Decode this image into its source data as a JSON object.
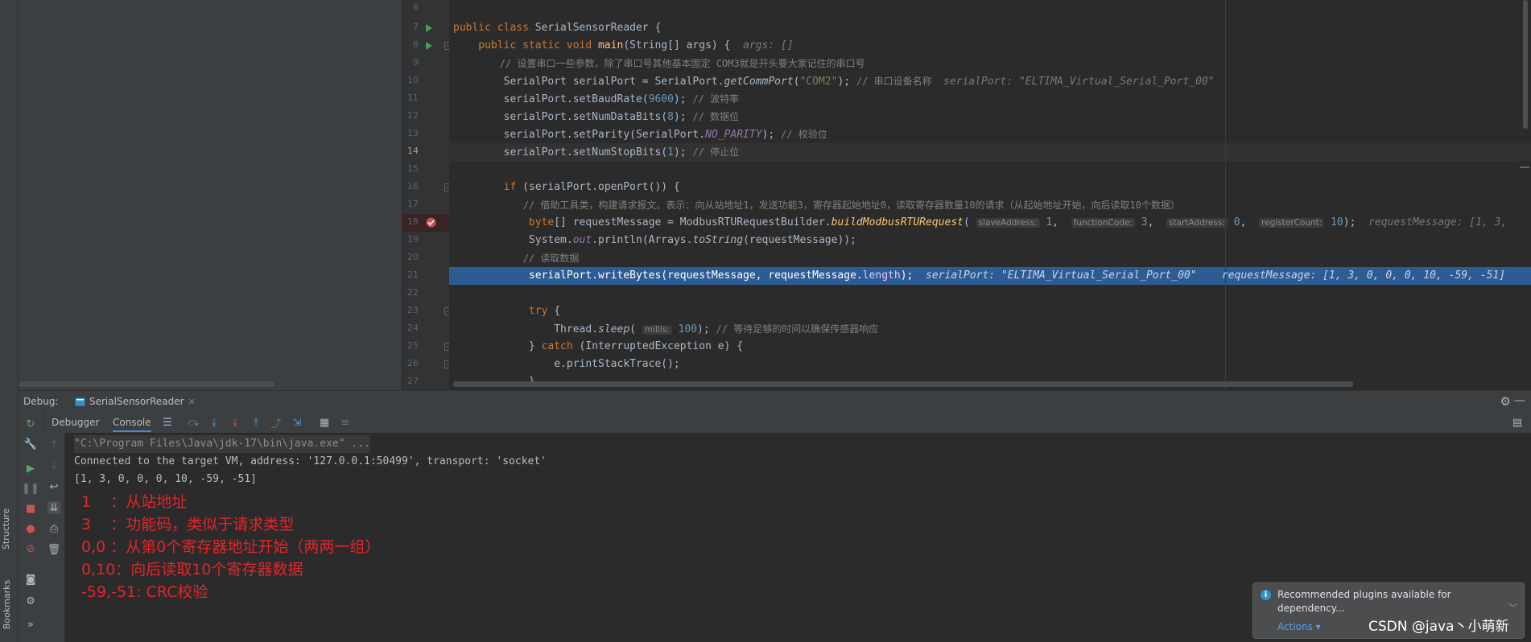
{
  "editor": {
    "lines": [
      {
        "num": "6"
      },
      {
        "num": "7"
      },
      {
        "num": "8"
      },
      {
        "num": "9"
      },
      {
        "num": "10"
      },
      {
        "num": "11"
      },
      {
        "num": "12"
      },
      {
        "num": "13"
      },
      {
        "num": "14"
      },
      {
        "num": "15"
      },
      {
        "num": "16"
      },
      {
        "num": "17"
      },
      {
        "num": "18"
      },
      {
        "num": "19"
      },
      {
        "num": "20"
      },
      {
        "num": "21"
      },
      {
        "num": "22"
      },
      {
        "num": "23"
      },
      {
        "num": "24"
      },
      {
        "num": "25"
      },
      {
        "num": "26"
      },
      {
        "num": "27"
      }
    ],
    "code": {
      "l7_kw": "public class ",
      "l7_name": "SerialSensorReader {",
      "l8_kw": "    public static void ",
      "l8_fn": "main",
      "l8_rest": "(String[] args) {  ",
      "l8_dbg": "args: []",
      "l9": "        // 设置串口一些参数，除了串口号其他基本固定 COM3就是开头要大家记住的串口号",
      "l10_a": "        SerialPort serialPort = SerialPort.",
      "l10_b": "getCommPort",
      "l10_c": "(",
      "l10_str": "\"COM2\"",
      "l10_d": "); ",
      "l10_cm": "// 串口设备名称  ",
      "l10_dbg": "serialPort: \"ELTIMA_Virtual_Serial_Port_00\"",
      "l11_a": "        serialPort.setBaudRate(",
      "l11_num": "9600",
      "l11_b": "); ",
      "l11_cm": "// 波特率",
      "l12_a": "        serialPort.setNumDataBits(",
      "l12_num": "8",
      "l12_b": "); ",
      "l12_cm": "// 数据位",
      "l13_a": "        serialPort.setParity(SerialPort.",
      "l13_st": "NO_PARITY",
      "l13_b": "); ",
      "l13_cm": "// 校验位",
      "l14_a": "        serialPort.setNumStopBits(",
      "l14_num": "1",
      "l14_b": "); ",
      "l14_cm": "// 停止位",
      "l16_kw": "        if ",
      "l16_rest": "(serialPort.openPort()) {",
      "l17": "            // 借助工具类，构建请求报文。表示：向从站地址1，发送功能3，寄存器起始地址0，读取寄存器数量10的请求（从起始地址开始，向后读取10个数据）",
      "l18_kw": "            byte",
      "l18_a": "[] requestMessage = ModbusRTURequestBuilder.",
      "l18_fn": "buildModbusRTURequest",
      "l18_b": "( ",
      "l18_h1": "slaveAddress:",
      "l18_v1": " 1",
      "l18_c1": ",  ",
      "l18_h2": "functionCode:",
      "l18_v2": " 3",
      "l18_c2": ",  ",
      "l18_h3": "startAddress:",
      "l18_v3": " 0",
      "l18_c3": ",  ",
      "l18_h4": "registerCount:",
      "l18_v4": " 10",
      "l18_end": ");  ",
      "l18_dbg": "requestMessage: [1, 3,",
      "l19_a": "            System.",
      "l19_out": "out",
      "l19_b": ".println(Arrays.",
      "l19_fn": "toString",
      "l19_c": "(requestMessage));",
      "l20": "            // 读取数据",
      "l21_a": "            serialPort.writeBytes(requestMessage, requestMessage.",
      "l21_len": "length",
      "l21_b": ");  ",
      "l21_dbg1": "serialPort: \"ELTIMA_Virtual_Serial_Port_00\"",
      "l21_sp": "    ",
      "l21_dbg2": "requestMessage: [1, 3, 0, 0, 0, 10, -59, -51]",
      "l23_kw": "            try ",
      "l23_rest": "{",
      "l24_a": "                Thread.",
      "l24_fn": "sleep",
      "l24_b": "( ",
      "l24_h": "millis:",
      "l24_num": " 100",
      "l24_c": "); ",
      "l24_cm": "// 等待足够的时间以确保传感器响应",
      "l25_a": "            } ",
      "l25_kw": "catch ",
      "l25_b": "(InterruptedException e) {",
      "l26": "                e.printStackTrace();",
      "l27": "            }"
    }
  },
  "debug": {
    "label": "Debug:",
    "tab_name": "SerialSensorReader",
    "tabs": [
      "Debugger",
      "Console"
    ]
  },
  "console": {
    "lines": [
      "\"C:\\Program Files\\Java\\jdk-17\\bin\\java.exe\" ...",
      "Connected to the target VM, address: '127.0.0.1:50499', transport: 'socket'",
      "[1, 3, 0, 0, 0, 10, -59, -51]"
    ],
    "annotations": [
      "1    ：从站地址",
      "3    ：功能码，类似于请求类型",
      "0,0 ：从第0个寄存器地址开始（两两一组）",
      "0,10：向后读取10个寄存器数据",
      "-59,-51: CRC校验"
    ]
  },
  "notification": {
    "text": "Recommended plugins available for dependency...",
    "action": "Actions"
  },
  "sidebar": {
    "structure": "Structure",
    "bookmarks": "Bookmarks"
  },
  "watermark": "CSDN @java丶小萌新",
  "colors": {
    "selection": "#2d5c94",
    "breakpoint_line": "#3a2323",
    "annotation_red": "#e0262b"
  }
}
